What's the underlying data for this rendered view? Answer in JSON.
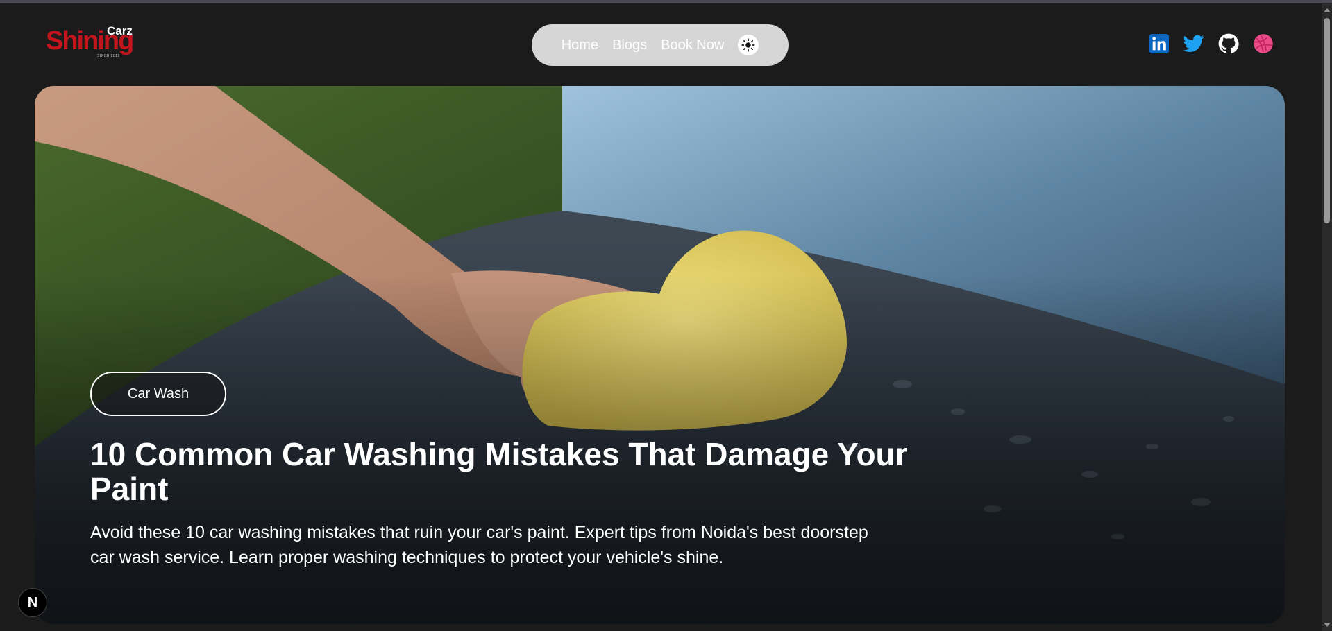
{
  "header": {
    "logo": {
      "brand": "Shining",
      "sub": "Carz",
      "since": "SINCE 2019"
    },
    "nav": [
      {
        "label": "Home"
      },
      {
        "label": "Blogs"
      },
      {
        "label": "Book Now"
      }
    ],
    "theme_toggle_icon": "sun-icon",
    "socials": [
      {
        "icon": "linkedin-icon",
        "color": "#0a66c2"
      },
      {
        "icon": "twitter-icon",
        "color": "#1da1f2"
      },
      {
        "icon": "github-icon",
        "color": "#ffffff"
      },
      {
        "icon": "dribbble-icon",
        "color": "#ea4c89"
      }
    ]
  },
  "hero": {
    "tag": "Car Wash",
    "title": "10 Common Car Washing Mistakes That Damage Your Paint",
    "description": "Avoid these 10 car washing mistakes that ruin your car's paint. Expert tips from Noida's best doorstep car wash service. Learn proper washing techniques to protect your vehicle's shine."
  },
  "next_badge": "N",
  "colors": {
    "background": "#1b1b1b",
    "brand_red": "#c4151c",
    "nav_pill": "#d6d6d6"
  }
}
